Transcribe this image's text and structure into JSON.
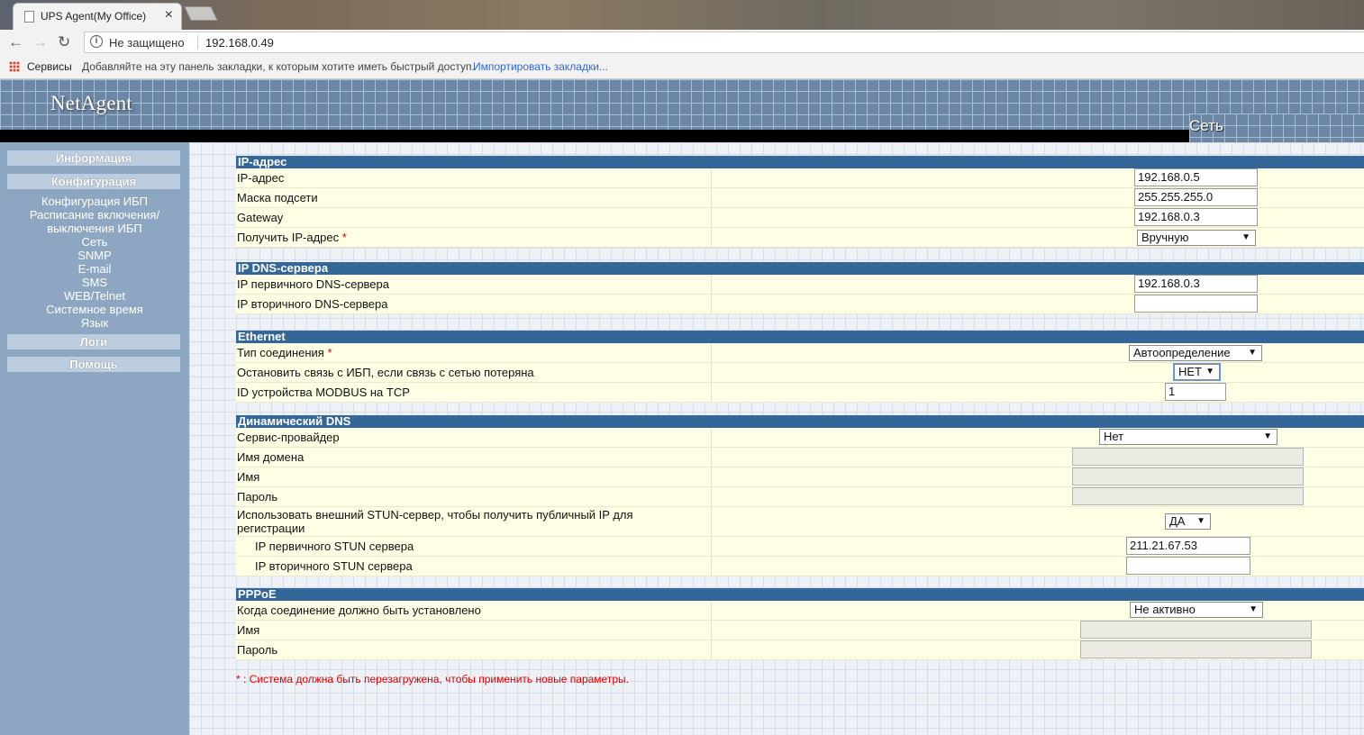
{
  "browser": {
    "tab_title": "UPS Agent(My Office)",
    "tab_close": "×",
    "security": "Не защищено",
    "url": "192.168.0.49",
    "bookmarks_apps": "Сервисы",
    "bookmarks_hint": "Добавляйте на эту панель закладки, к которым хотите иметь быстрый доступ.",
    "bookmarks_import": "Импортировать закладки..."
  },
  "header": {
    "logo": "NetAgent",
    "page_title": "Сеть"
  },
  "sidebar": {
    "info": "Информация",
    "config": "Конфигурация",
    "items": [
      "Конфигурация ИБП",
      "Расписание включения/",
      "выключения ИБП",
      "Сеть",
      "SNMP",
      "E-mail",
      "SMS",
      "WEB/Telnet",
      "Системное время",
      "Язык"
    ],
    "logs": "Логи",
    "help": "Помощь"
  },
  "ip": {
    "title": "IP-адрес",
    "ip_label": "IP-адрес",
    "ip_value": "192.168.0.5",
    "mask_label": "Маска подсети",
    "mask_value": "255.255.255.0",
    "gw_label": "Gateway",
    "gw_value": "192.168.0.3",
    "obtain_label": "Получить IP-адрес",
    "obtain_value": "Вручную"
  },
  "dns": {
    "title": "IP DNS-сервера",
    "primary_label": "IP первичного DNS-сервера",
    "primary_value": "192.168.0.3",
    "secondary_label": "IP вторичного DNS-сервера",
    "secondary_value": ""
  },
  "ethernet": {
    "title": "Ethernet",
    "conn_label": "Тип соединения",
    "conn_value": "Автоопределение",
    "stop_label": "Остановить связь с ИБП, если связь с сетью потеряна",
    "stop_value": "НЕТ",
    "modbus_label": "ID устройства MODBUS на TCP",
    "modbus_value": "1"
  },
  "ddns": {
    "title": "Динамический DNS",
    "provider_label": "Сервис-провайдер",
    "provider_value": "Нет",
    "domain_label": "Имя домена",
    "name_label": "Имя",
    "password_label": "Пароль",
    "stun_label_1": "Использовать внешний STUN-сервер, чтобы получить публичный IP для",
    "stun_label_2": "регистрации",
    "stun_value": "ДА",
    "stun_primary_label": "IP первичного STUN сервера",
    "stun_primary_value": "211.21.67.53",
    "stun_secondary_label": "IP вторичного STUN сервера",
    "stun_secondary_value": ""
  },
  "pppoe": {
    "title": "PPPoE",
    "when_label": "Когда соединение должно быть установлено",
    "when_value": "Не активно",
    "name_label": "Имя",
    "password_label": "Пароль"
  },
  "required_mark": "*",
  "footnote": "* : Система должна быть перезагружена, чтобы применить новые параметры.",
  "select_arrow": "▼"
}
